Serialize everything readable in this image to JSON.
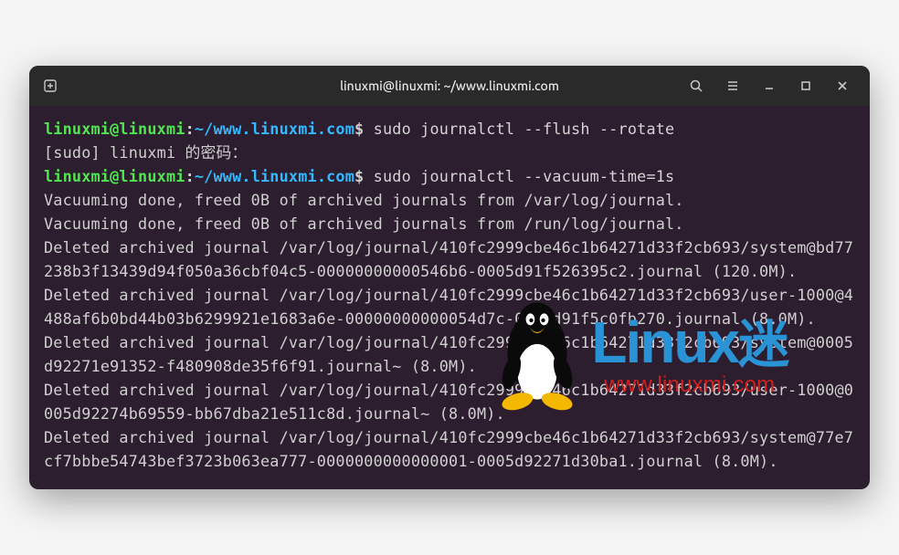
{
  "window": {
    "title": "linuxmi@linuxmi: ~/www.linuxmi.com"
  },
  "prompt": {
    "user": "linuxmi@linuxmi",
    "colon": ":",
    "path": "~/www.linuxmi.com",
    "dollar": "$"
  },
  "commands": {
    "cmd1": "sudo journalctl --flush --rotate",
    "sudo_prompt": "[sudo] linuxmi 的密码：",
    "cmd2": "sudo journalctl --vacuum-time=1s"
  },
  "output": {
    "l1": "Vacuuming done, freed 0B of archived journals from /var/log/journal.",
    "l2": "Vacuuming done, freed 0B of archived journals from /run/log/journal.",
    "l3": "Deleted archived journal /var/log/journal/410fc2999cbe46c1b64271d33f2cb693/system@bd77238b3f13439d94f050a36cbf04c5-00000000000546b6-0005d91f526395c2.journal (120.0M).",
    "l4": "Deleted archived journal /var/log/journal/410fc2999cbe46c1b64271d33f2cb693/user-1000@4488af6b0bd44b03b6299921e1683a6e-00000000000054d7c-0005d91f5c0fb270.journal (8.0M).",
    "l5": "Deleted archived journal /var/log/journal/410fc2999cbe46c1b64271d33f2cb693/system@0005d92271e91352-f480908de35f6f91.journal~ (8.0M).",
    "l6": "Deleted archived journal /var/log/journal/410fc2999cbe46c1b64271d33f2cb693/user-1000@0005d92274b69559-bb67dba21e511c8d.journal~ (8.0M).",
    "l7": "Deleted archived journal /var/log/journal/410fc2999cbe46c1b64271d33f2cb693/system@77e7cf7bbbe54743bef3723b063ea777-0000000000000001-0005d92271d30ba1.journal (8.0M)."
  },
  "watermark": {
    "title_en": "Linux",
    "title_cn": "迷",
    "url": "www.linuxmi.com"
  }
}
